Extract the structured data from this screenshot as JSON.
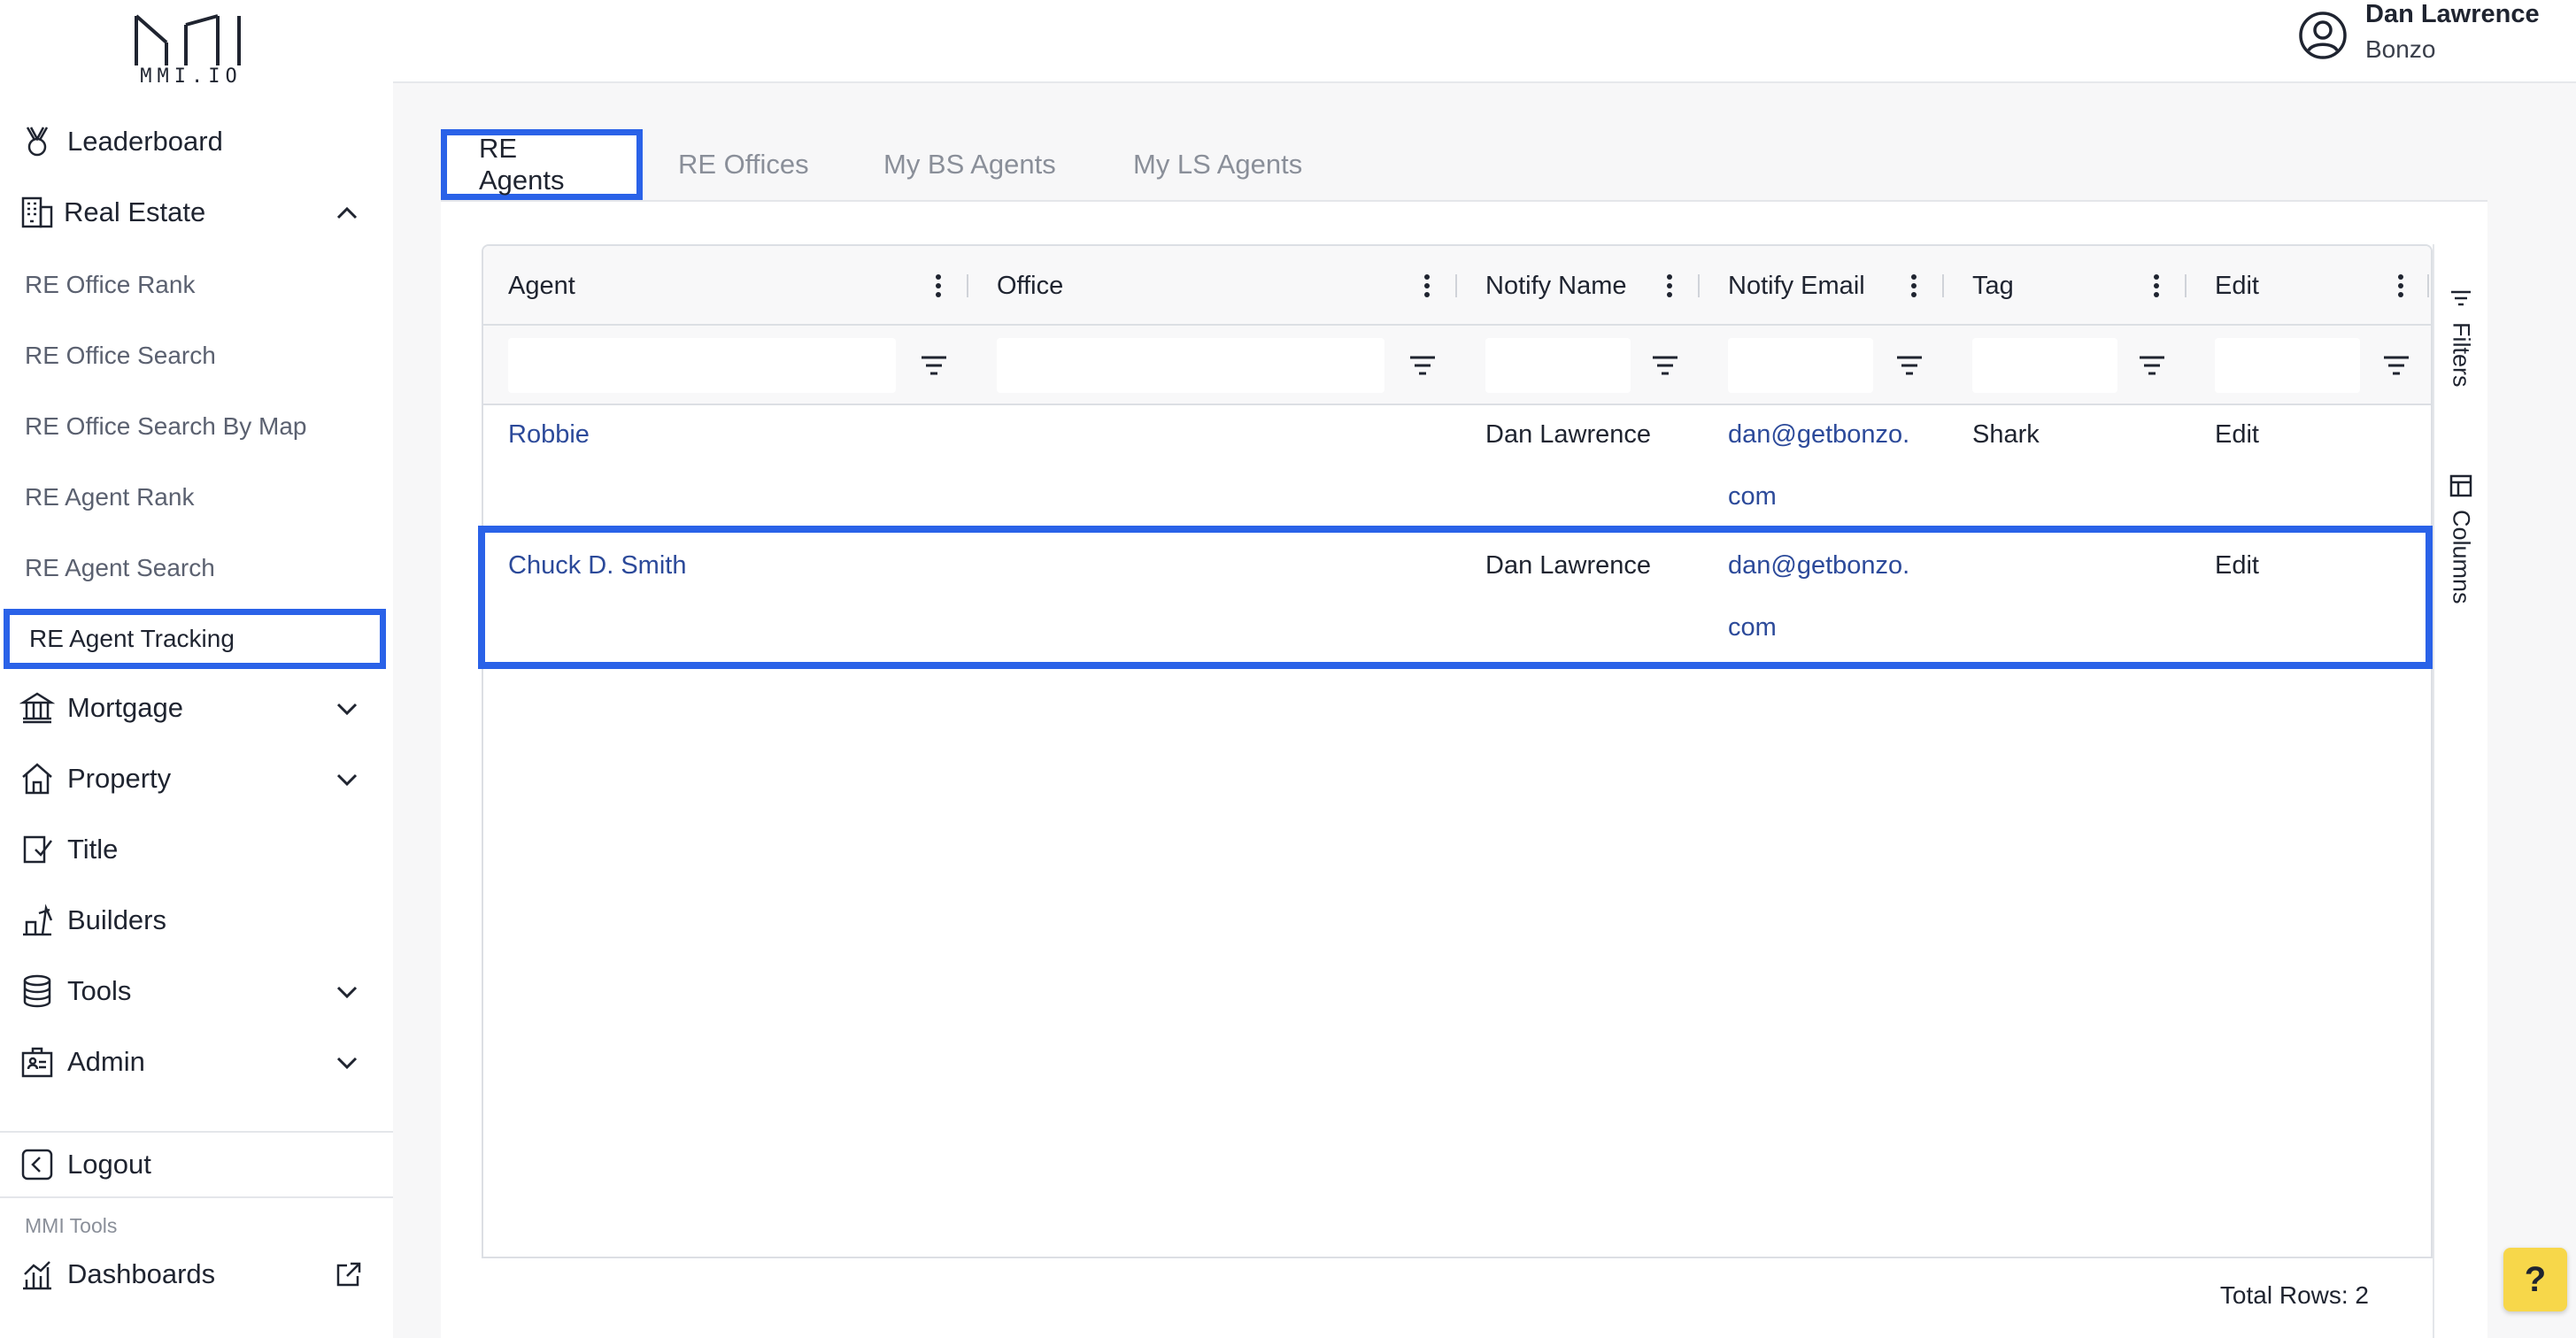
{
  "brand": {
    "logo_text": "MMI.IO"
  },
  "sidebar": {
    "items": [
      {
        "label": "Leaderboard",
        "icon": "medal-icon"
      },
      {
        "label": "Real Estate",
        "icon": "building-icon",
        "expanded": true
      },
      {
        "label": "Mortgage",
        "icon": "bank-icon",
        "expanded": false
      },
      {
        "label": "Property",
        "icon": "home-icon",
        "expanded": false
      },
      {
        "label": "Title",
        "icon": "title-certificate-icon"
      },
      {
        "label": "Builders",
        "icon": "builders-crane-icon"
      },
      {
        "label": "Tools",
        "icon": "database-icon",
        "expanded": false
      },
      {
        "label": "Admin",
        "icon": "admin-badge-icon",
        "expanded": false
      }
    ],
    "real_estate_sub": [
      "RE Office Rank",
      "RE Office Search",
      "RE Office Search By Map",
      "RE Agent Rank",
      "RE Agent Search",
      "RE Agent Tracking"
    ],
    "active_sub": "RE Agent Tracking",
    "logout": "Logout",
    "tools_section_label": "MMI Tools",
    "dashboards": "Dashboards"
  },
  "header": {
    "user_name": "Dan Lawrence",
    "user_org": "Bonzo"
  },
  "tabs": [
    {
      "label": "RE Agents",
      "active": true
    },
    {
      "label": "RE Offices",
      "active": false
    },
    {
      "label": "My BS Agents",
      "active": false
    },
    {
      "label": "My LS Agents",
      "active": false
    }
  ],
  "grid": {
    "columns": [
      "Agent",
      "Office",
      "Notify Name",
      "Notify Email",
      "Tag",
      "Edit"
    ],
    "rows": [
      {
        "agent": "Robbie",
        "office": "",
        "notify_name": "Dan Lawrence",
        "notify_email_1": "dan@getbonzo.",
        "notify_email_2": "com",
        "tag": "Shark",
        "edit": "Edit"
      },
      {
        "agent": "Chuck D. Smith",
        "office": "",
        "notify_name": "Dan Lawrence",
        "notify_email_1": "dan@getbonzo.",
        "notify_email_2": "com",
        "tag": "",
        "edit": "Edit"
      }
    ],
    "side_tools": [
      "Filters",
      "Columns"
    ],
    "total_rows": "Total Rows: 2"
  },
  "help": {
    "label": "?"
  },
  "colors": {
    "accent": "#2a62e8",
    "link": "#2c4a9a",
    "help": "#f7d74a"
  }
}
